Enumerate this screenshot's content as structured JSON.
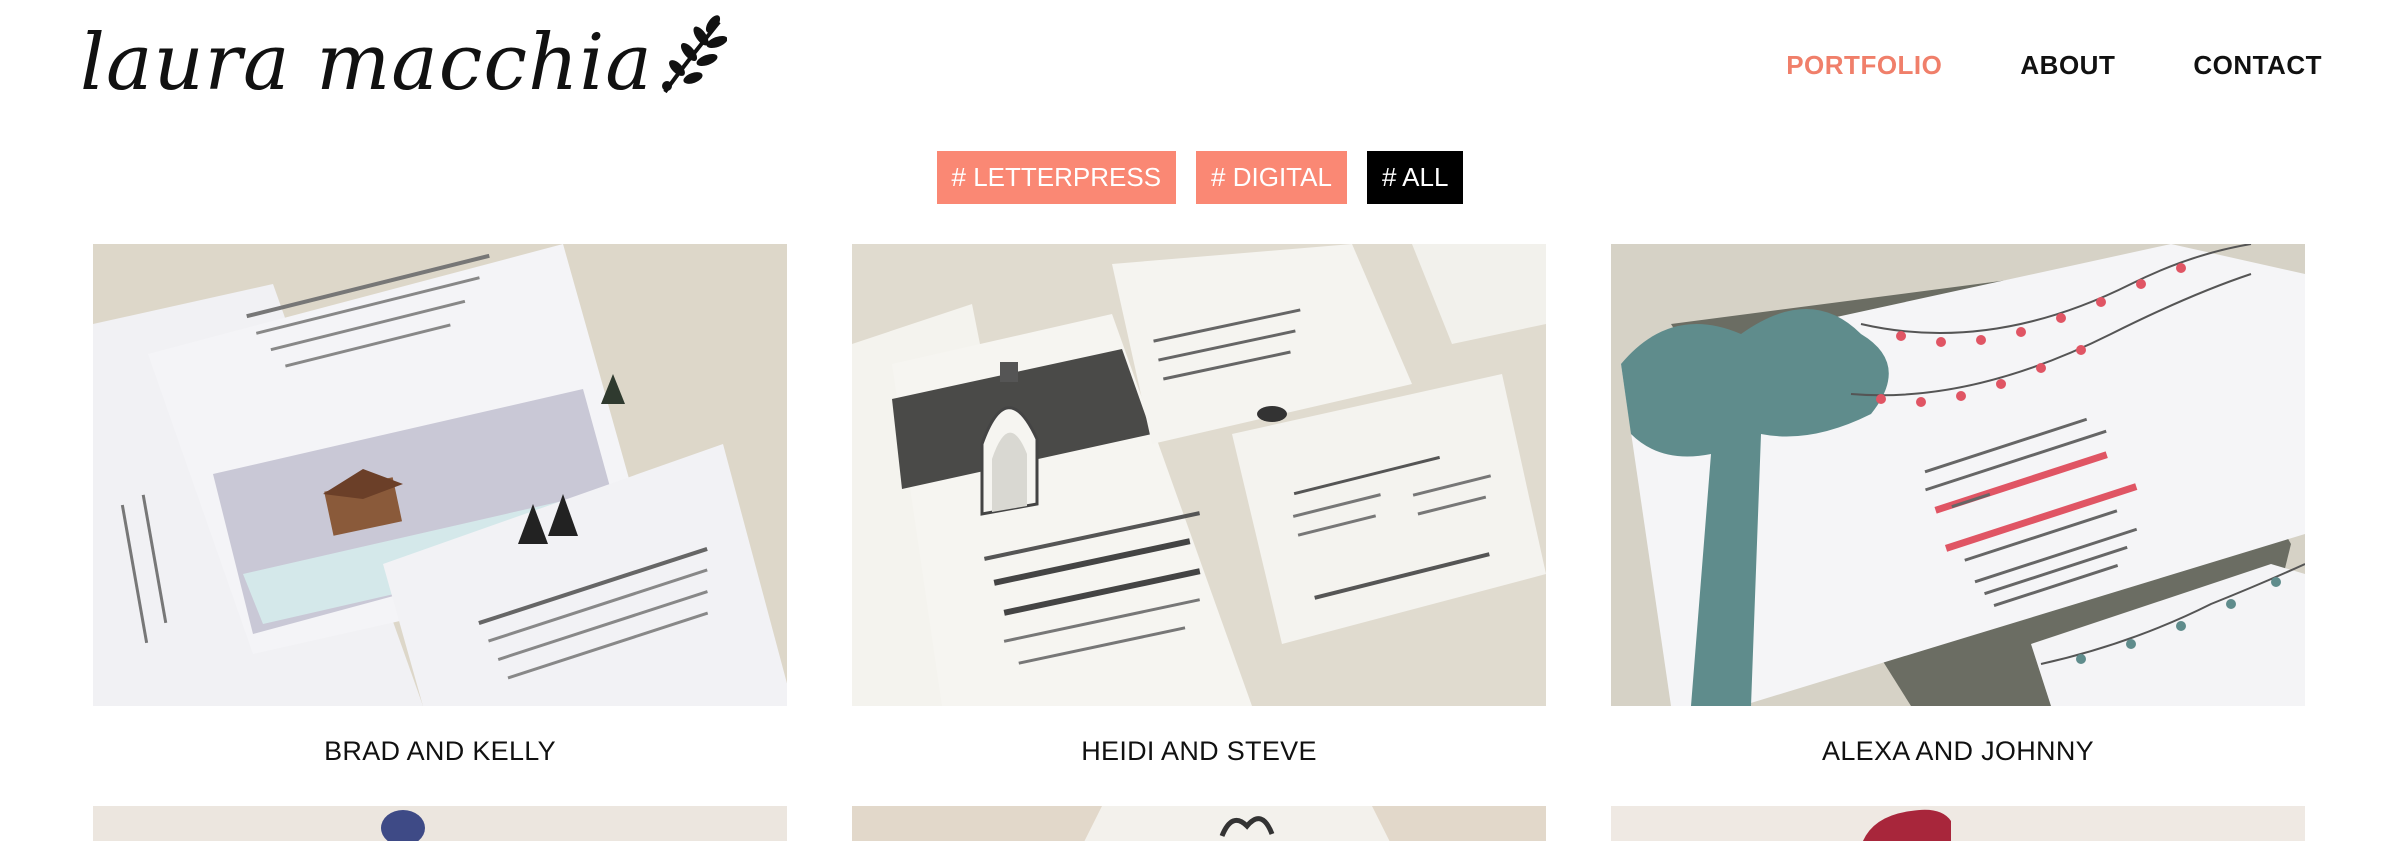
{
  "header": {
    "logo_text": "laura macchia",
    "nav": [
      {
        "label": "PORTFOLIO",
        "active": true
      },
      {
        "label": "ABOUT",
        "active": false
      },
      {
        "label": "CONTACT",
        "active": false
      }
    ]
  },
  "filters": [
    {
      "label": "# LETTERPRESS",
      "active": false
    },
    {
      "label": "# DIGITAL",
      "active": false
    },
    {
      "label": "# ALL",
      "active": true
    }
  ],
  "portfolio": [
    {
      "caption": "BRAD AND KELLY"
    },
    {
      "caption": "HEIDI AND STEVE"
    },
    {
      "caption": "ALEXA AND JOHNNY"
    }
  ],
  "colors": {
    "accent": "#f07f6a",
    "filter_bg": "#fa8874",
    "filter_active_bg": "#000000"
  }
}
